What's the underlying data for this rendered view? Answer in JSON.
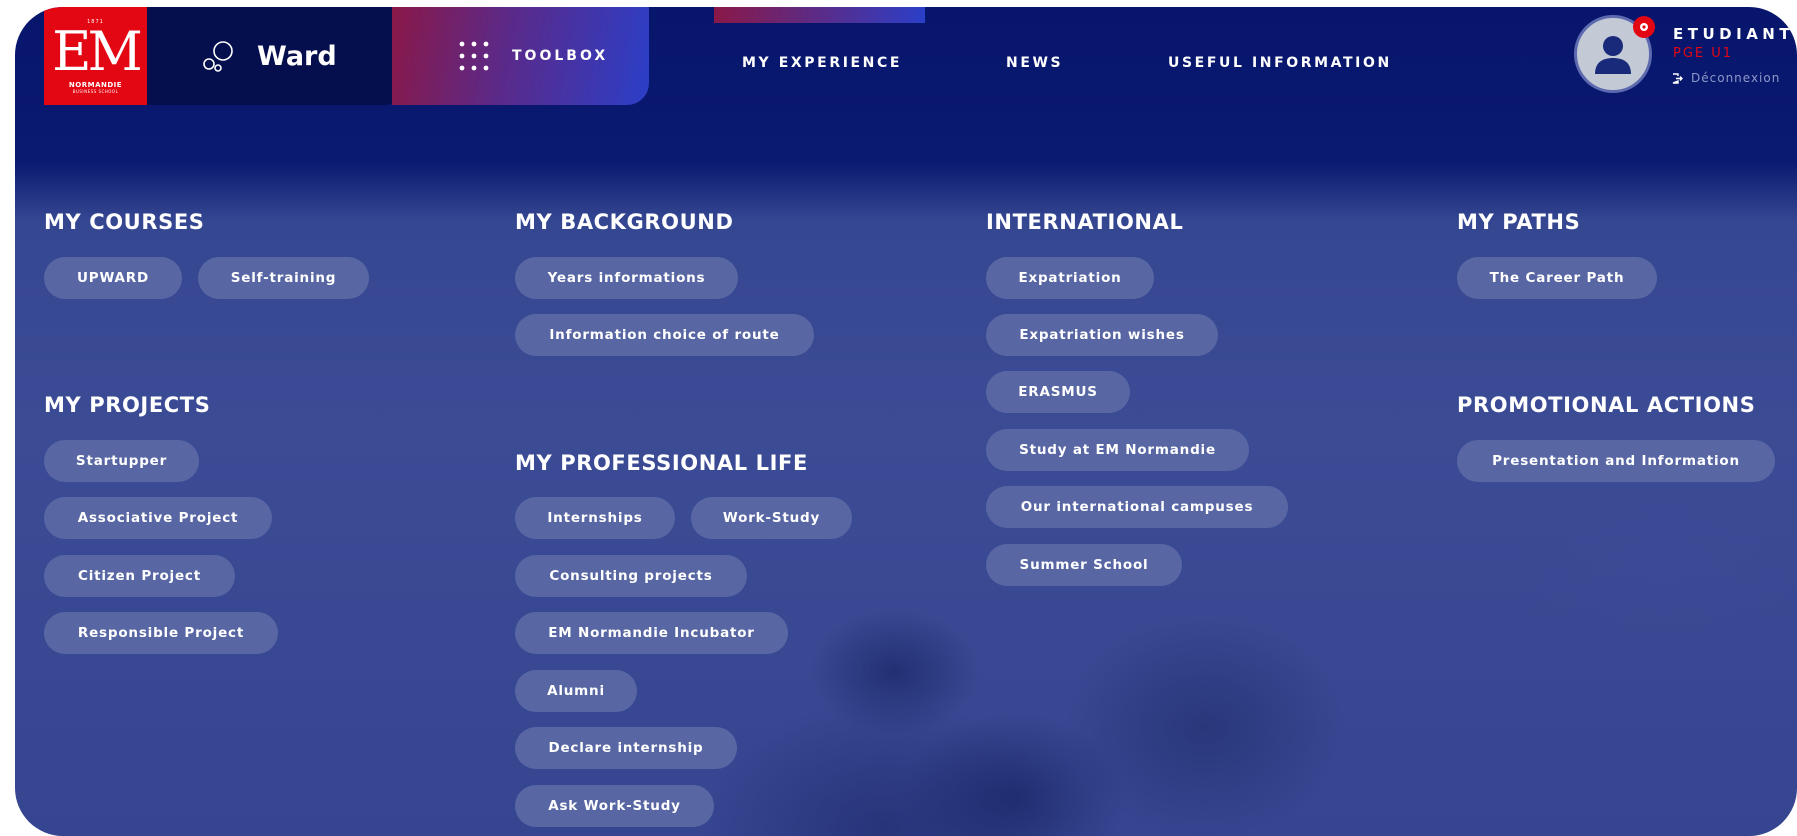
{
  "brand": {
    "year": "1871",
    "logo_letters": "EM",
    "logo_name": "NORMANDIE",
    "logo_tagline": "BUSINESS SCHOOL",
    "accent": "#e30613",
    "navy": "#07166c"
  },
  "tabs": {
    "ward": "Ward",
    "toolbox": "TOOLBOX",
    "ward_icon": "bubbles-icon",
    "toolbox_icon": "grid-dots-icon"
  },
  "nav": {
    "my_experience": "MY EXPERIENCE",
    "news": "NEWS",
    "useful_information": "USEFUL INFORMATION"
  },
  "user": {
    "name": "ETUDIANT",
    "program": "PGE U1",
    "logout": "Déconnexion"
  },
  "sections": {
    "my_courses": {
      "title": "MY COURSES",
      "items": [
        "UPWARD",
        "Self-training"
      ]
    },
    "my_projects": {
      "title": "MY PROJECTS",
      "items": [
        "Startupper",
        "Associative Project",
        "Citizen Project",
        "Responsible Project"
      ]
    },
    "my_background": {
      "title": "MY BACKGROUND",
      "items": [
        "Years informations",
        "Information choice of route"
      ]
    },
    "my_professional_life": {
      "title": "MY PROFESSIONAL LIFE",
      "items": [
        "Internships",
        "Work-Study",
        "Consulting projects",
        "EM Normandie Incubator",
        "Alumni",
        "Declare internship",
        "Ask Work-Study"
      ]
    },
    "international": {
      "title": "INTERNATIONAL",
      "items": [
        "Expatriation",
        "Expatriation wishes",
        "ERASMUS",
        "Study at EM Normandie",
        "Our international campuses",
        "Summer School"
      ]
    },
    "my_paths": {
      "title": "MY PATHS",
      "items": [
        "The Career Path"
      ]
    },
    "promotional_actions": {
      "title": "PROMOTIONAL ACTIONS",
      "items": [
        "Presentation and Information"
      ]
    }
  }
}
